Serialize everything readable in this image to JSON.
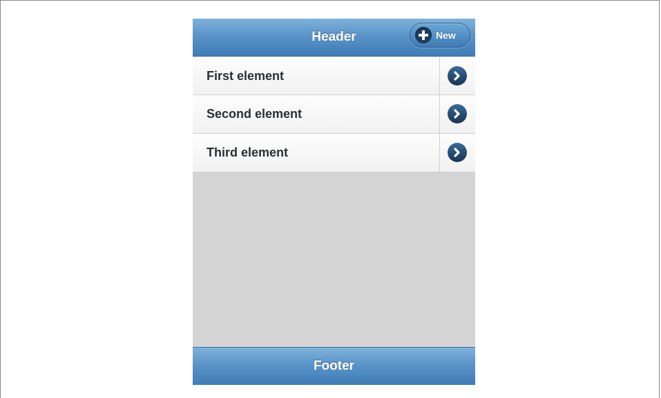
{
  "header": {
    "title": "Header",
    "new_button": {
      "label": "New",
      "icon": "plus-icon"
    }
  },
  "list": {
    "items": [
      {
        "label": "First element",
        "icon": "chevron-right-icon"
      },
      {
        "label": "Second element",
        "icon": "chevron-right-icon"
      },
      {
        "label": "Third element",
        "icon": "chevron-right-icon"
      }
    ]
  },
  "footer": {
    "title": "Footer"
  },
  "colors": {
    "bar_blue": "#5a94c8",
    "content_background": "#d4d4d4",
    "list_item_background": "#f6f6f6",
    "icon_dark_blue": "#1f3d5d",
    "text_dark": "#2b2f33"
  }
}
